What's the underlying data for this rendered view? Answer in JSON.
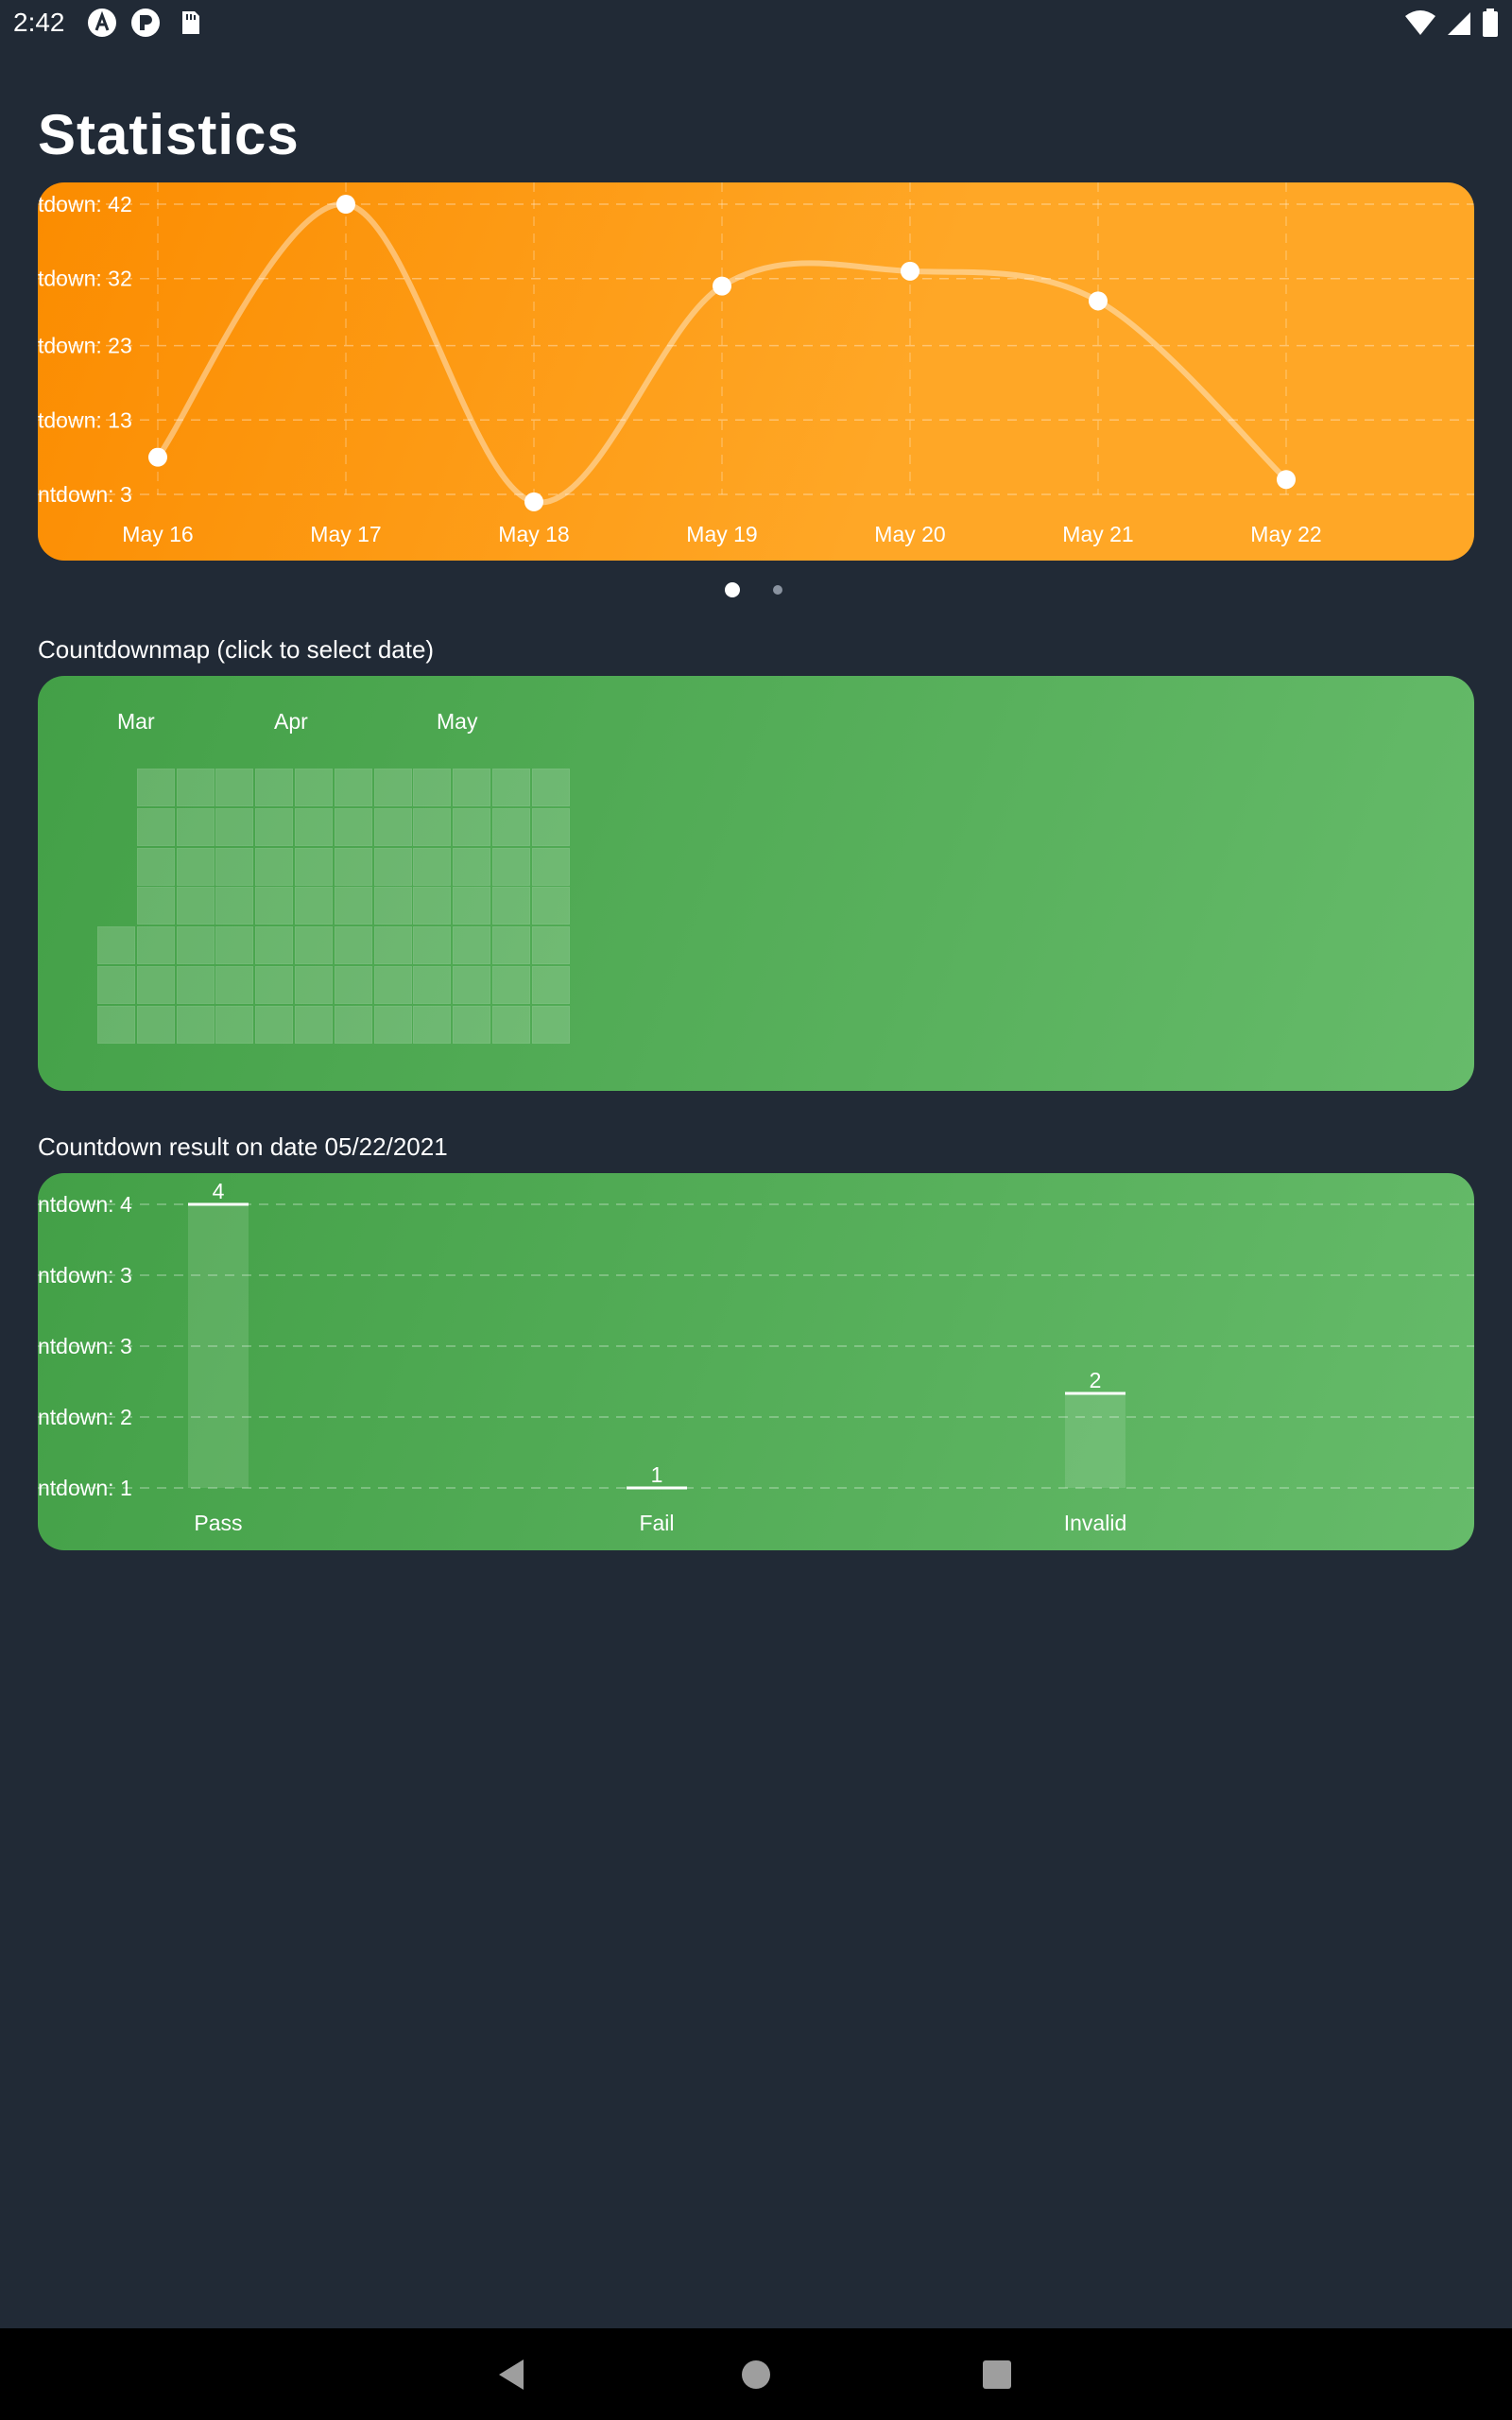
{
  "status_bar": {
    "time": "2:42",
    "left_icons": [
      "app-a-icon",
      "app-p-icon",
      "sd-card-icon"
    ],
    "right_icons": [
      "wifi-icon",
      "signal-icon",
      "battery-icon"
    ]
  },
  "page": {
    "title": "Statistics"
  },
  "line_chart": {
    "chart_data": {
      "type": "line",
      "x": [
        "May 16",
        "May 17",
        "May 18",
        "May 19",
        "May 20",
        "May 21",
        "May 22"
      ],
      "series": [
        {
          "values": [
            8,
            42,
            2,
            31,
            33,
            29,
            5
          ]
        }
      ],
      "y_tick_labels": [
        "tdown: 42",
        "tdown: 32",
        "tdown: 23",
        "tdown: 13",
        "ntdown: 3"
      ],
      "y_ticks": [
        42,
        32,
        23,
        13,
        3
      ],
      "ylim": [
        3,
        42
      ],
      "grid": true,
      "color": "#ffffff",
      "background": [
        "#fb8c00",
        "#ffa726"
      ]
    }
  },
  "pager": {
    "pages": 2,
    "active": 0
  },
  "heatmap": {
    "label": "Countdownmap (click to select date)",
    "months": [
      "Mar",
      "Apr",
      "May"
    ],
    "chart_data": {
      "type": "heatmap",
      "weeks": 12,
      "days_per_week": 7,
      "first_week_start_day": 4,
      "last_week_end_day": 6,
      "cell_color": "#ffffff",
      "cell_opacity": 0.18,
      "background": [
        "#43a047",
        "#66bb6a"
      ]
    }
  },
  "bar_chart": {
    "label": "Countdown result on date 05/22/2021",
    "chart_data": {
      "type": "bar",
      "categories": [
        "Pass",
        "Fail",
        "Invalid"
      ],
      "values": [
        4,
        1,
        2
      ],
      "y_tick_labels": [
        "ntdown: 4",
        "ntdown: 3",
        "ntdown: 3",
        "ntdown: 2",
        "ntdown: 1"
      ],
      "ylim": [
        1,
        4
      ],
      "grid": true,
      "background": [
        "#43a047",
        "#66bb6a"
      ]
    }
  },
  "nav_bar": {
    "buttons": [
      "back-icon",
      "home-icon",
      "recents-icon"
    ]
  }
}
